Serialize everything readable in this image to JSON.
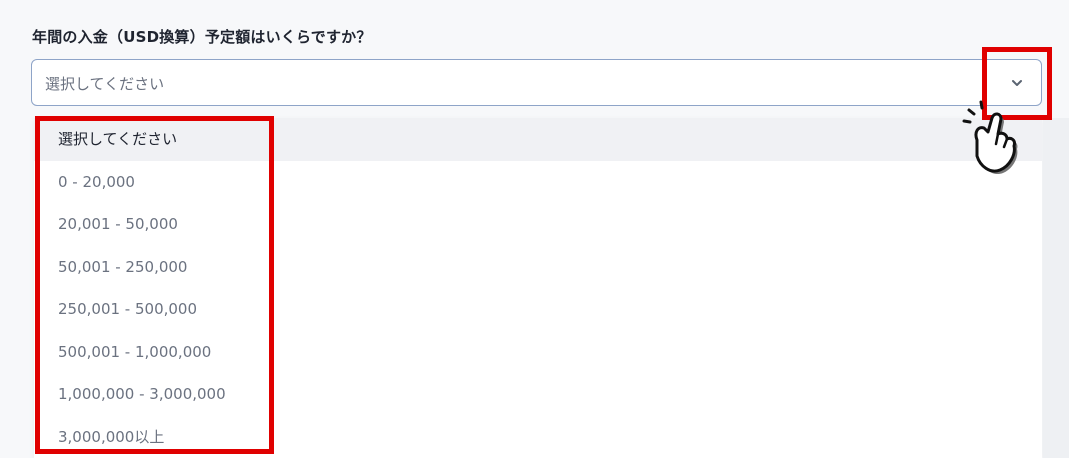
{
  "form": {
    "question": "年間の入金（USD換算）予定額はいくらですか？",
    "select_value": "選択してください"
  },
  "dropdown": {
    "options": [
      "選択してください",
      "0 - 20,000",
      "20,001 - 50,000",
      "50,001 - 250,000",
      "250,001 - 500,000",
      "500,001 - 1,000,000",
      "1,000,000 - 3,000,000",
      "3,000,000以上"
    ],
    "selected_index": 0
  },
  "colors": {
    "highlight": "#e00000",
    "input_border": "#8ea4c8",
    "option_text": "#6b7280"
  },
  "icons": {
    "chevron": "chevron-down-icon",
    "cursor": "pointing-hand-cursor-icon"
  }
}
